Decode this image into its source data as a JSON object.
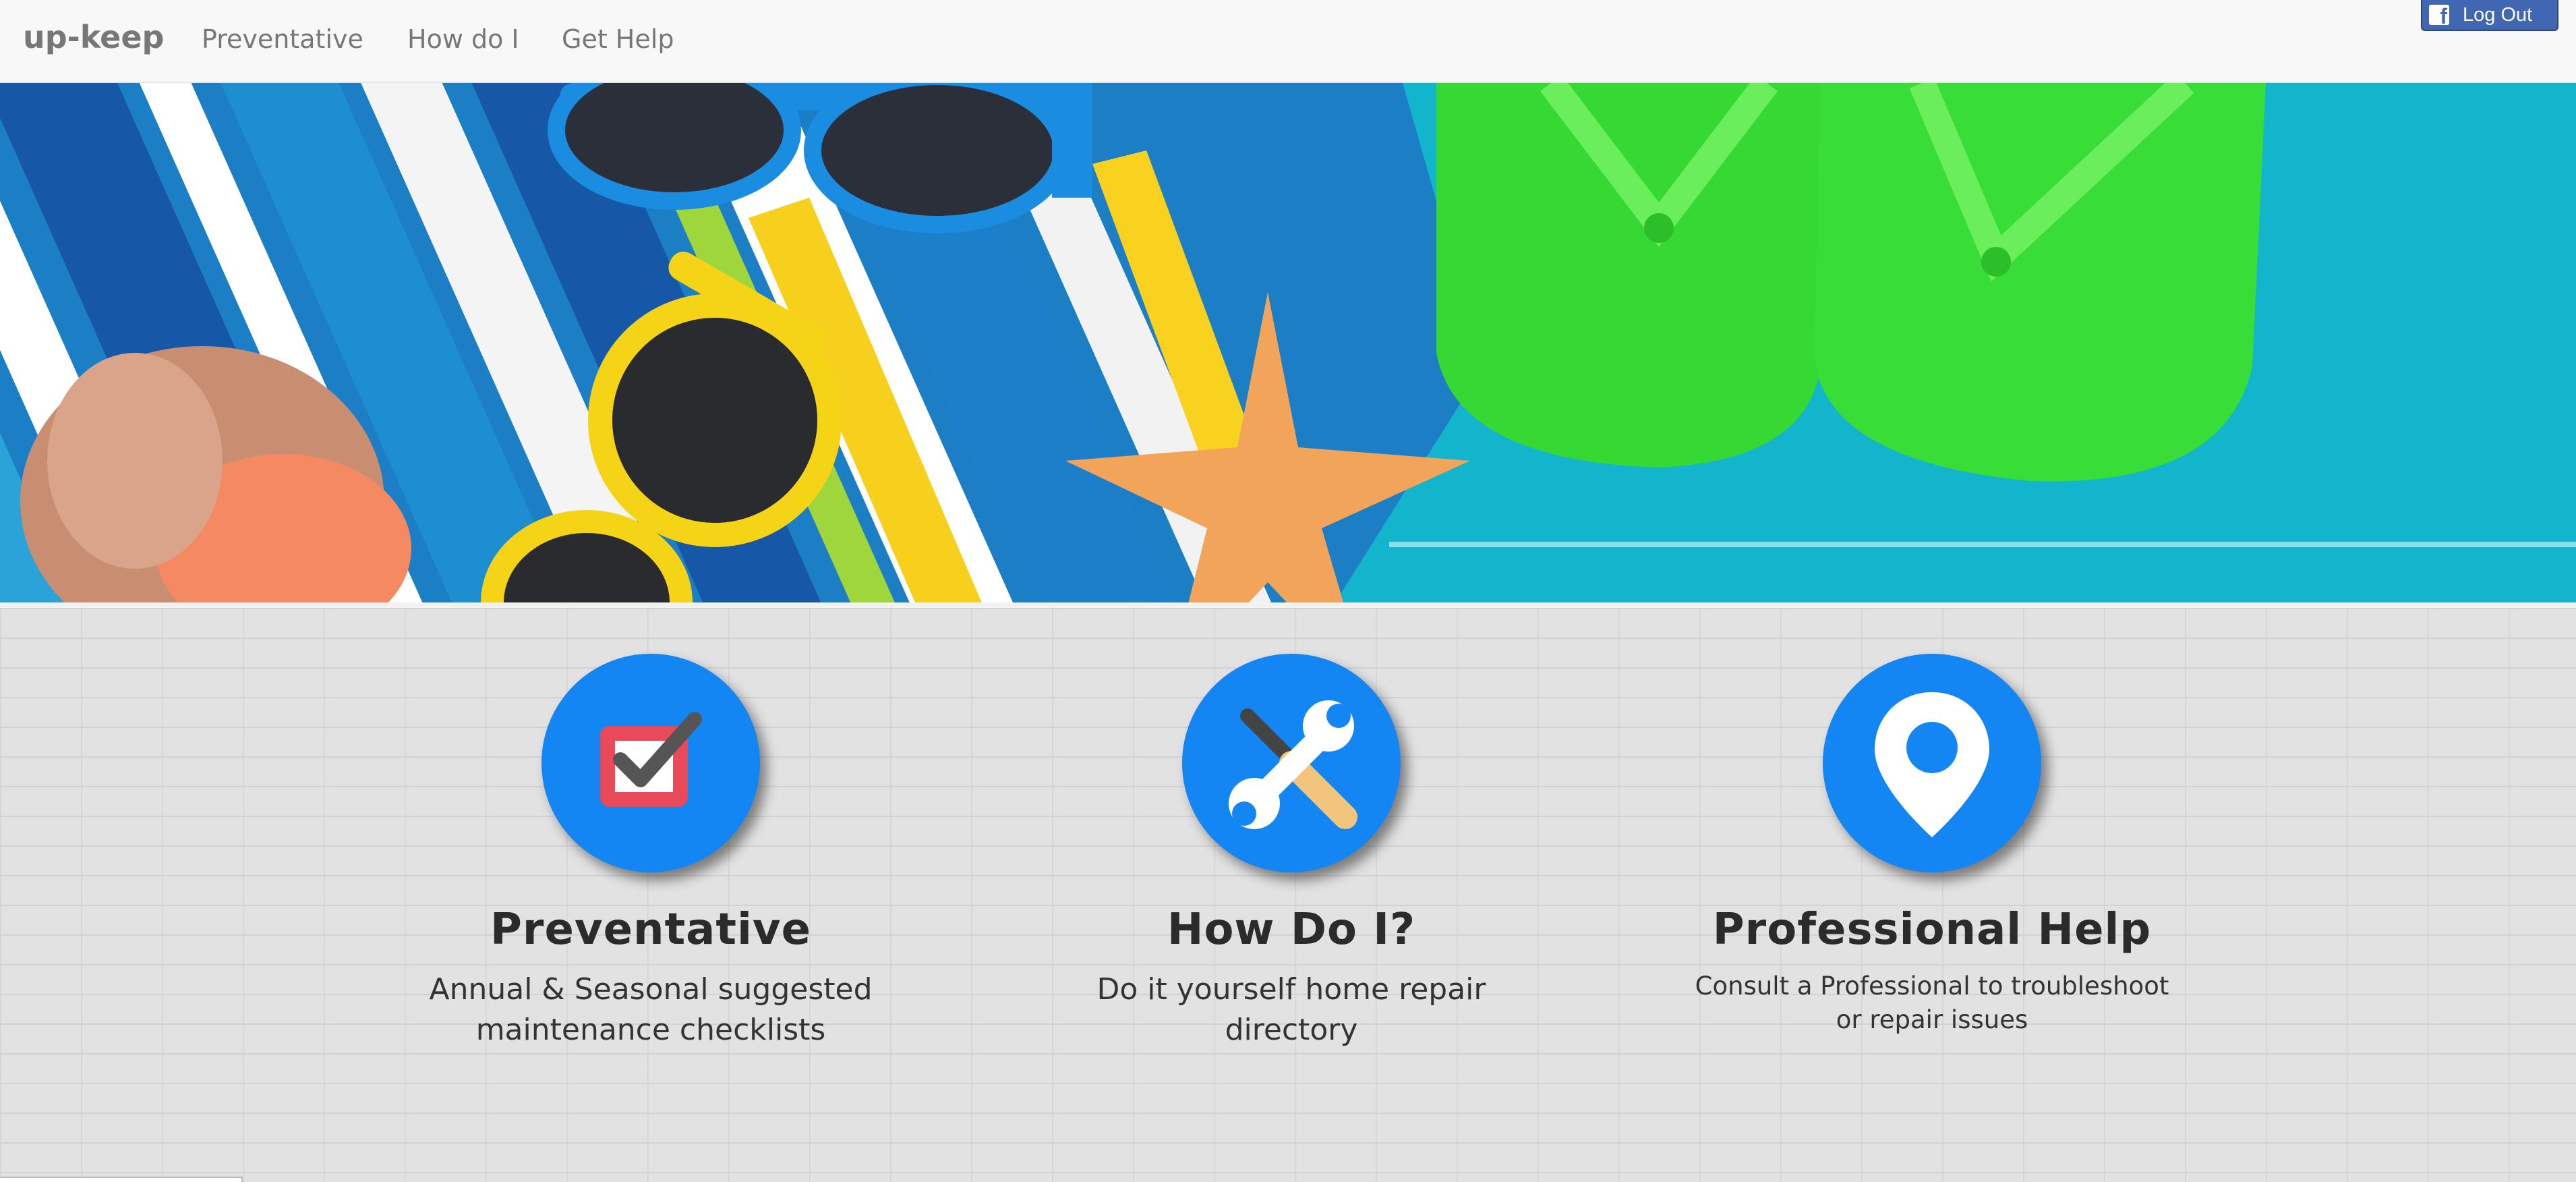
{
  "navbar": {
    "brand": "up-keep",
    "links": [
      "Preventative",
      "How do I",
      "Get Help"
    ],
    "facebook_button": {
      "label": "Log Out",
      "icon": "facebook-f-icon",
      "color": "#4267b2"
    }
  },
  "hero": {
    "image_description_icon": "beach-scene-image"
  },
  "features": [
    {
      "icon": "checkbox-checked-icon",
      "title": "Preventative",
      "description": "Annual & Seasonal suggested maintenance checklists"
    },
    {
      "icon": "tools-icon",
      "title": "How Do I?",
      "description": "Do it yourself home repair directory"
    },
    {
      "icon": "location-pin-icon",
      "title": "Professional Help",
      "description": "Consult a Professional to troubleshoot or repair issues"
    }
  ],
  "colors": {
    "accent": "#1386f3",
    "navbar_bg": "#f8f8f8",
    "nav_text": "#777777"
  }
}
